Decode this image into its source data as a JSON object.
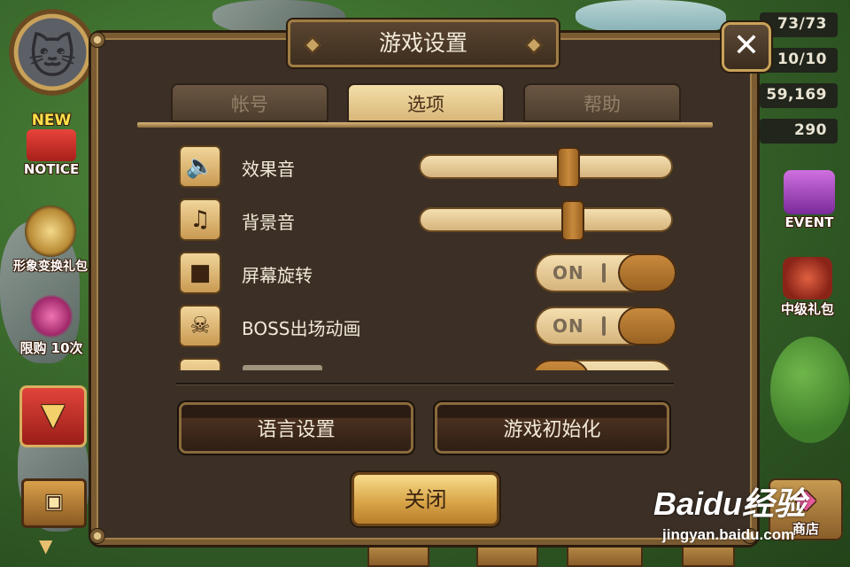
{
  "hud": {
    "resources": [
      "73/73",
      "10/10",
      "59,169",
      "290"
    ],
    "side_left": [
      {
        "label": "NOTICE",
        "badge": "NEW"
      },
      {
        "label": "形象变换礼包"
      },
      {
        "label": "限购 10次"
      }
    ],
    "side_right": [
      {
        "label": "EVENT"
      },
      {
        "label": "中级礼包"
      },
      {
        "label": "商店"
      }
    ]
  },
  "dialog": {
    "title": "游戏设置",
    "close_symbol": "✕",
    "tabs": [
      {
        "label": "帐号",
        "active": false
      },
      {
        "label": "选项",
        "active": true
      },
      {
        "label": "帮助",
        "active": false
      }
    ],
    "settings": [
      {
        "icon": "speaker-icon",
        "label": "效果音",
        "control": "slider",
        "value": 0.6
      },
      {
        "icon": "music-note-icon",
        "label": "背景音",
        "control": "slider",
        "value": 0.62
      },
      {
        "icon": "camera-icon",
        "label": "屏幕旋转",
        "control": "toggle",
        "state": "ON"
      },
      {
        "icon": "boss-icon",
        "label": "BOSS出场动画",
        "control": "toggle",
        "state": "ON"
      }
    ],
    "buttons": {
      "language": "语言设置",
      "reset": "游戏初始化",
      "close": "关闭"
    }
  },
  "watermark": {
    "logo": "Baidu经验",
    "url": "jingyan.baidu.com"
  },
  "colors": {
    "panel": "#3c3026",
    "gold": "#c9a25a",
    "text": "#f2ead8"
  }
}
